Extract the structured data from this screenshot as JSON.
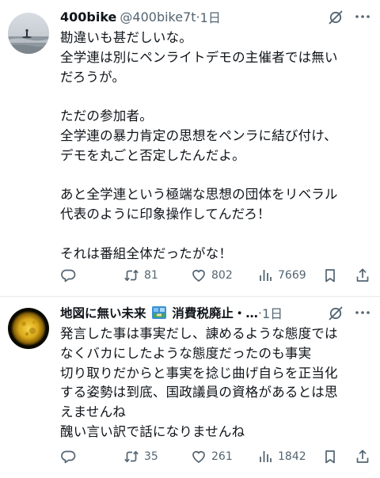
{
  "tweets": [
    {
      "display_name": "400bike",
      "handle": "@400bike7t",
      "separator": "·",
      "time": "1日",
      "text": "勘違いも甚だしいな。\n全学連は別にペンライトデモの主催者では無い\nだろうが。\n\nただの参加者。\n全学連の暴力肯定の思想をペンラに結び付け、\nデモを丸ごと否定したんだよ。\n\nあと全学連という極端な思想の団体をリベラル\n代表のように印象操作してんだろ！\n\nそれは番組全体だったがな！",
      "replies": "",
      "retweets": "81",
      "likes": "802",
      "views": "7669",
      "avatar_icon": "beach-surfer-avatar"
    },
    {
      "display_name": "地図に無い未来",
      "display_name_suffix": "消費税廃止・…",
      "handle": "",
      "separator": "·",
      "time": "1日",
      "text": "発言した事は事実だし、諌めるような態度では\nなくバカにしたような態度だったのも事実\n切り取りだからと事実を捻じ曲げ自らを正当化\nする姿勢は到底、国政議員の資格があるとは思\nえませんね\n醜い言い訳で話になりませんね",
      "replies": "",
      "retweets": "35",
      "likes": "261",
      "views": "1842",
      "avatar_icon": "golden-sun-avatar"
    }
  ],
  "icons": {
    "grok": "grok-icon",
    "more": "more-icon",
    "reply": "reply-icon",
    "retweet": "retweet-icon",
    "like": "like-icon",
    "views": "views-icon",
    "bookmark": "bookmark-icon",
    "share": "share-icon",
    "flag": "flag-emoji-icon"
  },
  "colors": {
    "text": "#0f1419",
    "secondary": "#536471",
    "divider": "#e6e9ec"
  }
}
